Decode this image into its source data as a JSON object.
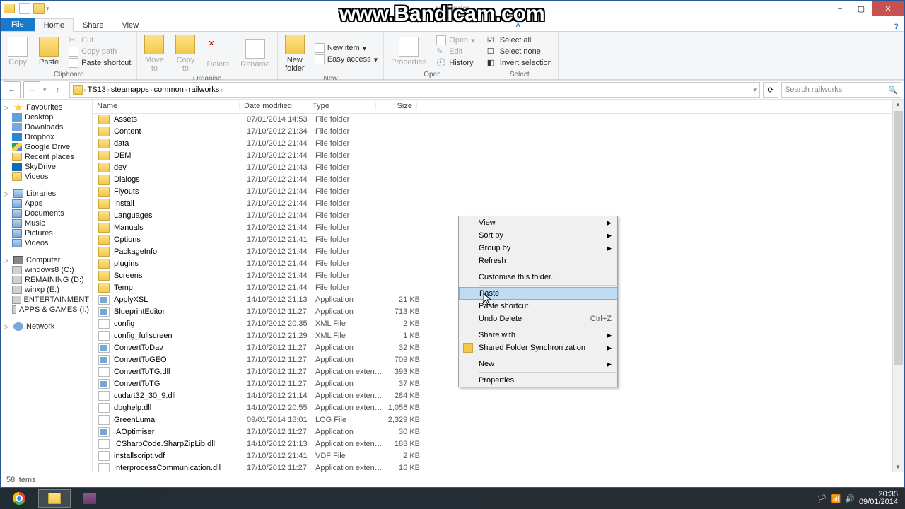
{
  "watermark": "www.Bandicam.com",
  "window": {
    "title": "railworks"
  },
  "controls": {
    "min": "–",
    "max": "▢",
    "close": "✕"
  },
  "tabs": {
    "file": "File",
    "home": "Home",
    "share": "Share",
    "view": "View"
  },
  "ribbon": {
    "clipboard": {
      "label": "Clipboard",
      "copy": "Copy",
      "paste": "Paste",
      "cut": "Cut",
      "copy_path": "Copy path",
      "paste_shortcut": "Paste shortcut"
    },
    "organise": {
      "label": "Organise",
      "move": "Move\nto",
      "copy_to": "Copy\nto",
      "delete": "Delete",
      "rename": "Rename"
    },
    "new": {
      "label": "New",
      "new_folder": "New\nfolder",
      "new_item": "New item",
      "easy_access": "Easy access"
    },
    "open": {
      "label": "Open",
      "properties": "Properties",
      "open": "Open",
      "edit": "Edit",
      "history": "History"
    },
    "select": {
      "label": "Select",
      "all": "Select all",
      "none": "Select none",
      "invert": "Invert selection"
    }
  },
  "breadcrumb": {
    "items": [
      "TS13",
      "steamapps",
      "common",
      "railworks"
    ]
  },
  "search": {
    "placeholder": "Search railworks"
  },
  "nav": {
    "favourites": "Favourites",
    "fav_items": [
      "Desktop",
      "Downloads",
      "Dropbox",
      "Google Drive",
      "Recent places",
      "SkyDrive",
      "Videos"
    ],
    "libraries": "Libraries",
    "lib_items": [
      "Apps",
      "Documents",
      "Music",
      "Pictures",
      "Videos"
    ],
    "computer": "Computer",
    "computer_items": [
      "windows8 (C:)",
      "REMAINING (D:)",
      "winxp (E:)",
      "ENTERTAINMENT",
      "APPS & GAMES (I:)"
    ],
    "network": "Network"
  },
  "columns": {
    "name": "Name",
    "date": "Date modified",
    "type": "Type",
    "size": "Size"
  },
  "files": [
    {
      "n": "Assets",
      "d": "07/01/2014 14:53",
      "t": "File folder",
      "s": "",
      "k": "folder"
    },
    {
      "n": "Content",
      "d": "17/10/2012 21:34",
      "t": "File folder",
      "s": "",
      "k": "folder"
    },
    {
      "n": "data",
      "d": "17/10/2012 21:44",
      "t": "File folder",
      "s": "",
      "k": "folder"
    },
    {
      "n": "DEM",
      "d": "17/10/2012 21:44",
      "t": "File folder",
      "s": "",
      "k": "folder"
    },
    {
      "n": "dev",
      "d": "17/10/2012 21:43",
      "t": "File folder",
      "s": "",
      "k": "folder"
    },
    {
      "n": "Dialogs",
      "d": "17/10/2012 21:44",
      "t": "File folder",
      "s": "",
      "k": "folder"
    },
    {
      "n": "Flyouts",
      "d": "17/10/2012 21:44",
      "t": "File folder",
      "s": "",
      "k": "folder"
    },
    {
      "n": "Install",
      "d": "17/10/2012 21:44",
      "t": "File folder",
      "s": "",
      "k": "folder"
    },
    {
      "n": "Languages",
      "d": "17/10/2012 21:44",
      "t": "File folder",
      "s": "",
      "k": "folder"
    },
    {
      "n": "Manuals",
      "d": "17/10/2012 21:44",
      "t": "File folder",
      "s": "",
      "k": "folder"
    },
    {
      "n": "Options",
      "d": "17/10/2012 21:41",
      "t": "File folder",
      "s": "",
      "k": "folder"
    },
    {
      "n": "PackageInfo",
      "d": "17/10/2012 21:44",
      "t": "File folder",
      "s": "",
      "k": "folder"
    },
    {
      "n": "plugins",
      "d": "17/10/2012 21:44",
      "t": "File folder",
      "s": "",
      "k": "folder"
    },
    {
      "n": "Screens",
      "d": "17/10/2012 21:44",
      "t": "File folder",
      "s": "",
      "k": "folder"
    },
    {
      "n": "Temp",
      "d": "17/10/2012 21:44",
      "t": "File folder",
      "s": "",
      "k": "folder"
    },
    {
      "n": "ApplyXSL",
      "d": "14/10/2012 21:13",
      "t": "Application",
      "s": "21 KB",
      "k": "exe"
    },
    {
      "n": "BlueprintEditor",
      "d": "17/10/2012 11:27",
      "t": "Application",
      "s": "713 KB",
      "k": "exe"
    },
    {
      "n": "config",
      "d": "17/10/2012 20:35",
      "t": "XML File",
      "s": "2 KB",
      "k": "file"
    },
    {
      "n": "config_fullscreen",
      "d": "17/10/2012 21:29",
      "t": "XML File",
      "s": "1 KB",
      "k": "file"
    },
    {
      "n": "ConvertToDav",
      "d": "17/10/2012 11:27",
      "t": "Application",
      "s": "32 KB",
      "k": "exe"
    },
    {
      "n": "ConvertToGEO",
      "d": "17/10/2012 11:27",
      "t": "Application",
      "s": "709 KB",
      "k": "exe"
    },
    {
      "n": "ConvertToTG.dll",
      "d": "17/10/2012 11:27",
      "t": "Application extens...",
      "s": "393 KB",
      "k": "file"
    },
    {
      "n": "ConvertToTG",
      "d": "17/10/2012 11:27",
      "t": "Application",
      "s": "37 KB",
      "k": "exe"
    },
    {
      "n": "cudart32_30_9.dll",
      "d": "14/10/2012 21:14",
      "t": "Application extens...",
      "s": "284 KB",
      "k": "file"
    },
    {
      "n": "dbghelp.dll",
      "d": "14/10/2012 20:55",
      "t": "Application extens...",
      "s": "1,056 KB",
      "k": "file"
    },
    {
      "n": "GreenLuma",
      "d": "09/01/2014 18:01",
      "t": "LOG File",
      "s": "2,329 KB",
      "k": "file"
    },
    {
      "n": "IAOptimiser",
      "d": "17/10/2012 11:27",
      "t": "Application",
      "s": "30 KB",
      "k": "exe"
    },
    {
      "n": "ICSharpCode.SharpZipLib.dll",
      "d": "14/10/2012 21:13",
      "t": "Application extens...",
      "s": "188 KB",
      "k": "file"
    },
    {
      "n": "installscript.vdf",
      "d": "17/10/2012 21:41",
      "t": "VDF File",
      "s": "2 KB",
      "k": "file"
    },
    {
      "n": "InterprocessCommunication.dll",
      "d": "17/10/2012 11:27",
      "t": "Application extens...",
      "s": "16 KB",
      "k": "file"
    }
  ],
  "ctx": {
    "view": "View",
    "sort": "Sort by",
    "group": "Group by",
    "refresh": "Refresh",
    "customise": "Customise this folder...",
    "paste": "Paste",
    "paste_shortcut": "Paste shortcut",
    "undo": "Undo Delete",
    "undo_sc": "Ctrl+Z",
    "share": "Share with",
    "shared_sync": "Shared Folder Synchronization",
    "new": "New",
    "properties": "Properties"
  },
  "status": {
    "items": "58 items"
  },
  "clock": {
    "time": "20:35",
    "date": "09/01/2014"
  }
}
